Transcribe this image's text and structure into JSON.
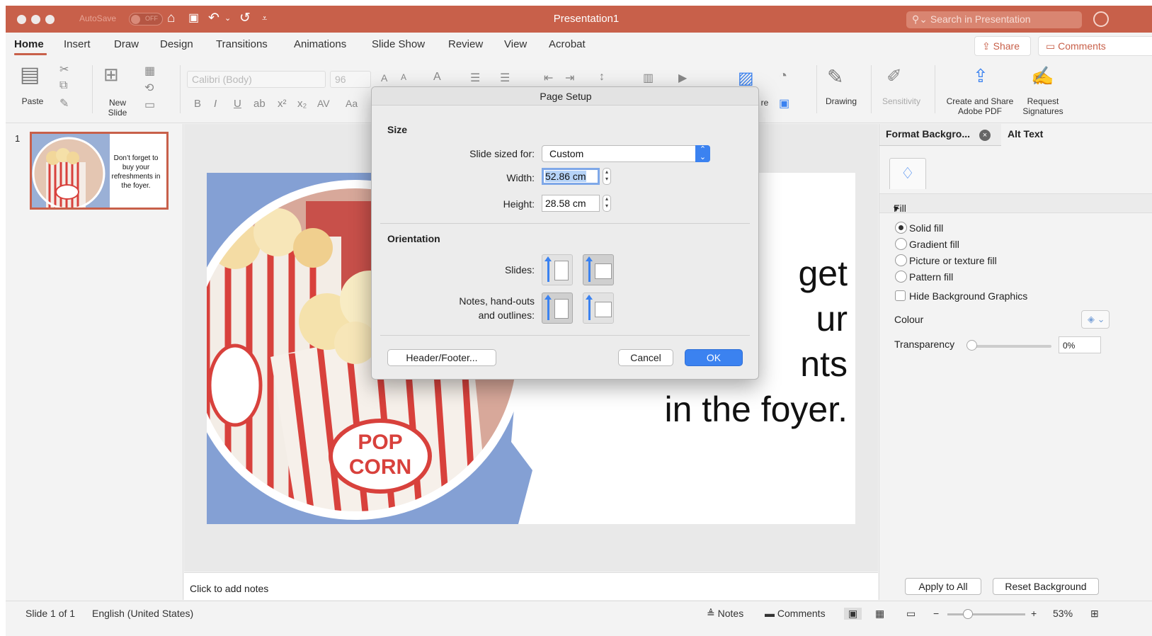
{
  "titlebar": {
    "autosave_label": "AutoSave",
    "autosave_state": "OFF",
    "doc_title": "Presentation1",
    "search_placeholder": "Search in Presentation"
  },
  "tabs": [
    "Home",
    "Insert",
    "Draw",
    "Design",
    "Transitions",
    "Animations",
    "Slide Show",
    "Review",
    "View",
    "Acrobat"
  ],
  "active_tab": "Home",
  "share_label": "Share",
  "comments_label": "Comments",
  "ribbon": {
    "paste": "Paste",
    "new_slide_line1": "New",
    "new_slide_line2": "Slide",
    "font_name": "Calibri (Body)",
    "font_size": "96",
    "drawing": "Drawing",
    "sensitivity": "Sensitivity",
    "create_share_line1": "Create and Share",
    "create_share_line2": "Adobe PDF",
    "request_line1": "Request",
    "request_line2": "Signatures",
    "picture_partial": "re"
  },
  "thumbnail": {
    "number": "1",
    "text": "Don’t forget to buy your refreshments in the foyer."
  },
  "slide": {
    "line1": "get",
    "line2": "ur",
    "line3": "nts",
    "line4": "in the foyer."
  },
  "notes_placeholder": "Click to add notes",
  "format_pane": {
    "tab1": "Format Backgro...",
    "tab2": "Alt Text",
    "fill_header": "Fill",
    "options": [
      "Solid fill",
      "Gradient fill",
      "Picture or texture fill",
      "Pattern fill"
    ],
    "selected_option": "Solid fill",
    "hide_bg": "Hide Background Graphics",
    "hide_bg_checked": false,
    "colour": "Colour",
    "transparency": "Transparency",
    "transparency_value": "0%",
    "apply_all": "Apply to All",
    "reset": "Reset Background",
    "fill_color": "#ffffff"
  },
  "statusbar": {
    "slide_count": "Slide 1 of 1",
    "language": "English (United States)",
    "notes": "Notes",
    "comments": "Comments",
    "zoom": "53%"
  },
  "dialog": {
    "title": "Page Setup",
    "size_header": "Size",
    "slide_sized_for_label": "Slide sized for:",
    "slide_sized_for_value": "Custom",
    "width_label": "Width:",
    "width_value": "52.86 cm",
    "height_label": "Height:",
    "height_value": "28.58 cm",
    "orientation_header": "Orientation",
    "slides_label": "Slides:",
    "notes_label_line1": "Notes, hand-outs",
    "notes_label_line2": "and outlines:",
    "slides_orientation_selected": "landscape",
    "notes_orientation_selected": "portrait",
    "header_footer": "Header/Footer...",
    "cancel": "Cancel",
    "ok": "OK"
  },
  "colors": {
    "brand": "#c8604a",
    "accent_blue": "#3b82f0"
  }
}
